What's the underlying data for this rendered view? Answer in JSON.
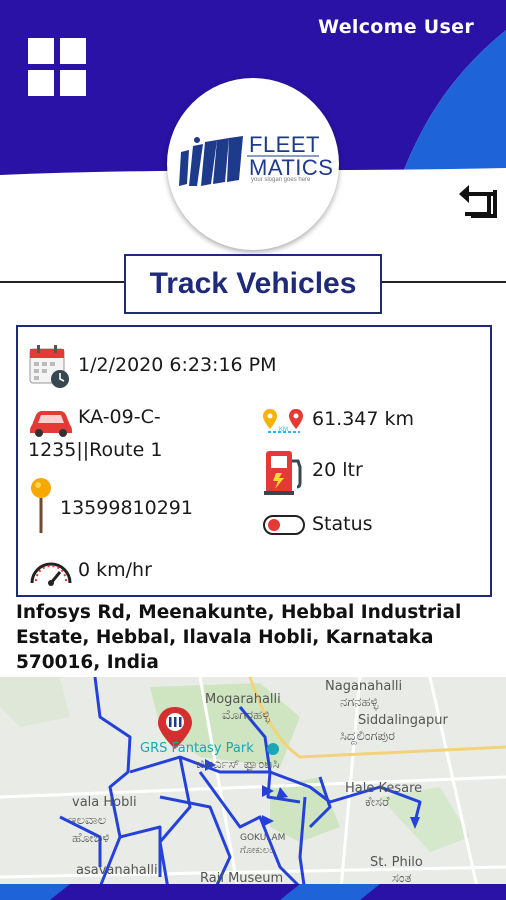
{
  "header": {
    "welcome_text": "Welcome User",
    "primary_color": "#2a12a6",
    "accent_color": "#1d6fe0"
  },
  "logo": {
    "line1": "FLEET",
    "line2": "MATICS",
    "slogan": "your slogan goes here"
  },
  "page": {
    "title": "Track Vehicles"
  },
  "vehicle": {
    "datetime": "1/2/2020 6:23:16 PM",
    "plate_route": "KA-09-C-\n1235||Route 1",
    "plate_line1": "KA-09-C-",
    "plate_line2": "1235||Route 1",
    "distance": "61.347 km",
    "fuel": "20 ltr",
    "phone": "13599810291",
    "status_label": "Status",
    "speed": "0 km/hr"
  },
  "location": {
    "address": "Infosys Rd, Meenakunte, Hebbal Industrial Estate, Hebbal, Ilavala Hobli, Karnataka 570016, India"
  },
  "map": {
    "labels": {
      "naganahalli_en": "Naganahalli",
      "naganahalli_kn": "ನಗನಹಳ್ಳಿ",
      "mogarahalli_en": "Mogarahalli",
      "mogarahalli_kn": "ಮೊಗರಹಳ್ಳಿ",
      "siddalingapur_en": "Siddalingapur",
      "siddalingapur_kn": "ಸಿದ್ದಲಿಂಗಪುರ",
      "fantasy_park": "GRS Fantasy Park",
      "fantasy_park_kn": "ಜಿಆರ್ಎಸ್ ಫ್ಯಾಂಟಸಿ",
      "hole_kesare_en": "Hale Kesare",
      "hole_kesare_kn": "ಕೇಸರೆ",
      "ilavala_en": "vala Hobli",
      "ilavala_kn1": "ಇಲವಾಲ",
      "ilavala_kn2": "ಹೋಬಳಿ",
      "gokulam_en": "GOKULAM",
      "gokulam_kn": "ಗೋಕುಲಂ",
      "asavanahalli": "asavanahalli",
      "rail_museum": "Rail Museum",
      "st_philo_en": "St. Philo",
      "st_philo_kn": "ಸಂತ"
    }
  }
}
